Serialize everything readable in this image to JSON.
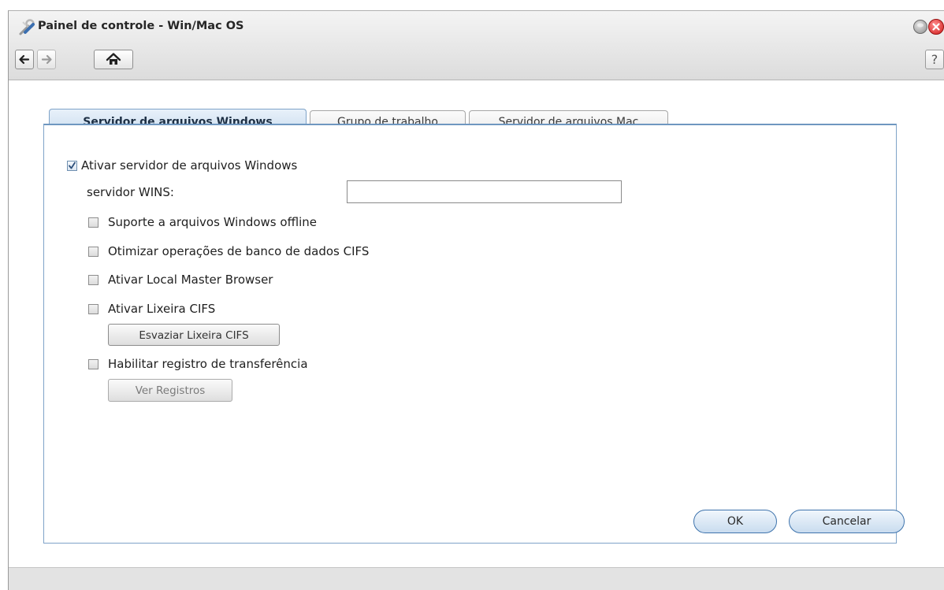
{
  "window": {
    "title": "Painel de controle - Win/Mac OS",
    "help_label": "?"
  },
  "tabs": [
    {
      "label": "Servidor de arquivos Windows",
      "active": true
    },
    {
      "label": "Grupo de trabalho",
      "active": false
    },
    {
      "label": "Servidor de arquivos Mac",
      "active": false
    }
  ],
  "form": {
    "enable_windows_label": "Ativar servidor de arquivos Windows",
    "enable_windows_checked": true,
    "wins_label": "servidor WINS:",
    "wins_value": "",
    "options": [
      {
        "label": "Suporte a arquivos Windows offline",
        "checked": false
      },
      {
        "label": "Otimizar operações de banco de dados CIFS",
        "checked": false
      },
      {
        "label": "Ativar Local Master Browser",
        "checked": false
      },
      {
        "label": "Ativar Lixeira CIFS",
        "checked": false
      },
      {
        "label": "Habilitar registro de transferência",
        "checked": false
      }
    ],
    "empty_recycle_label": "Esvaziar Lixeira CIFS",
    "view_logs_label": "Ver Registros"
  },
  "actions": {
    "ok_label": "OK",
    "cancel_label": "Cancelar"
  },
  "colors": {
    "accent": "#3f74ad",
    "tab_active_bg": "#c9dcee",
    "close_red": "#d01818"
  },
  "icons": [
    "tools-icon",
    "minimize-icon",
    "close-icon",
    "back-arrow-icon",
    "forward-arrow-icon",
    "home-icon",
    "help-icon",
    "checkmark-icon"
  ]
}
